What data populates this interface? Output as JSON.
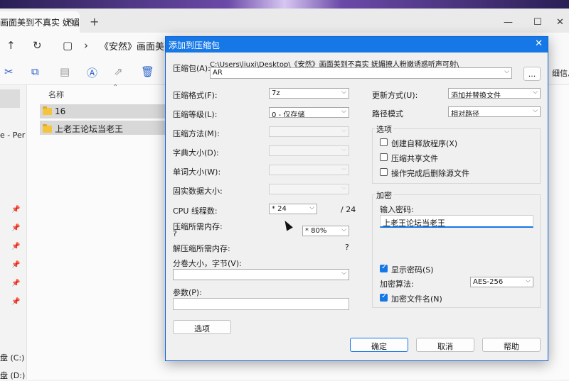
{
  "explorer": {
    "tab_title": "画面美到不真实 妩媚",
    "tab_close": "×",
    "tab_new": "+",
    "window_controls": {
      "minimize": "—",
      "maximize": "☐",
      "close": "✕"
    },
    "nav": {
      "up": "↑",
      "refresh": "↻",
      "view": "▢",
      "chevron": "›"
    },
    "address": "《安然》画面美到不真实",
    "toolbar_right": "细信息",
    "sidebar": {
      "item_1": "e - Per",
      "drive_c": "盘 (C:)",
      "drive_d": "盘 (D:)"
    },
    "column_name": "名称",
    "rows": [
      "16",
      "上老王论坛当老王"
    ]
  },
  "dialog": {
    "title": "添加到压缩包",
    "close": "✕",
    "archive_label": "压缩包(A):",
    "archive_path": "C:\\Users\\liuxi\\Desktop\\《安然》画面美到不真实 妩媚撩人粉嫩诱惑听声可射\\",
    "archive_name": "AR",
    "browse_label": "...",
    "format_label": "压缩格式(F):",
    "format_value": "7z",
    "level_label": "压缩等级(L):",
    "level_value": "0 - 仅存储",
    "method_label": "压缩方法(M):",
    "dict_label": "字典大小(D):",
    "word_label": "单词大小(W):",
    "solid_label": "固实数据大小:",
    "cpu_label": "CPU 线程数:",
    "cpu_value": "* 24",
    "cpu_total": "/ 24",
    "mem_comp_label": "压缩所需内存:",
    "mem_comp_value": "?",
    "mem_percent": "* 80%",
    "mem_decomp_label": "解压缩所需内存:",
    "mem_decomp_value": "?",
    "split_label": "分卷大小，字节(V):",
    "params_label": "参数(P):",
    "options_button": "选项",
    "update_label": "更新方式(U):",
    "update_value": "添加并替换文件",
    "pathmode_label": "路径模式",
    "pathmode_value": "相对路径",
    "options_group": "选项",
    "opt_sfx": "创建自释放程序(X)",
    "opt_shared": "压缩共享文件",
    "opt_delete": "操作完成后删除源文件",
    "encrypt_group": "加密",
    "pwd_label": "输入密码:",
    "pwd_value": "上老王论坛当老王",
    "show_pwd": "显示密码(S)",
    "enc_method_label": "加密算法:",
    "enc_method_value": "AES-256",
    "enc_names": "加密文件名(N)",
    "ok": "确定",
    "cancel": "取消",
    "help": "帮助"
  }
}
